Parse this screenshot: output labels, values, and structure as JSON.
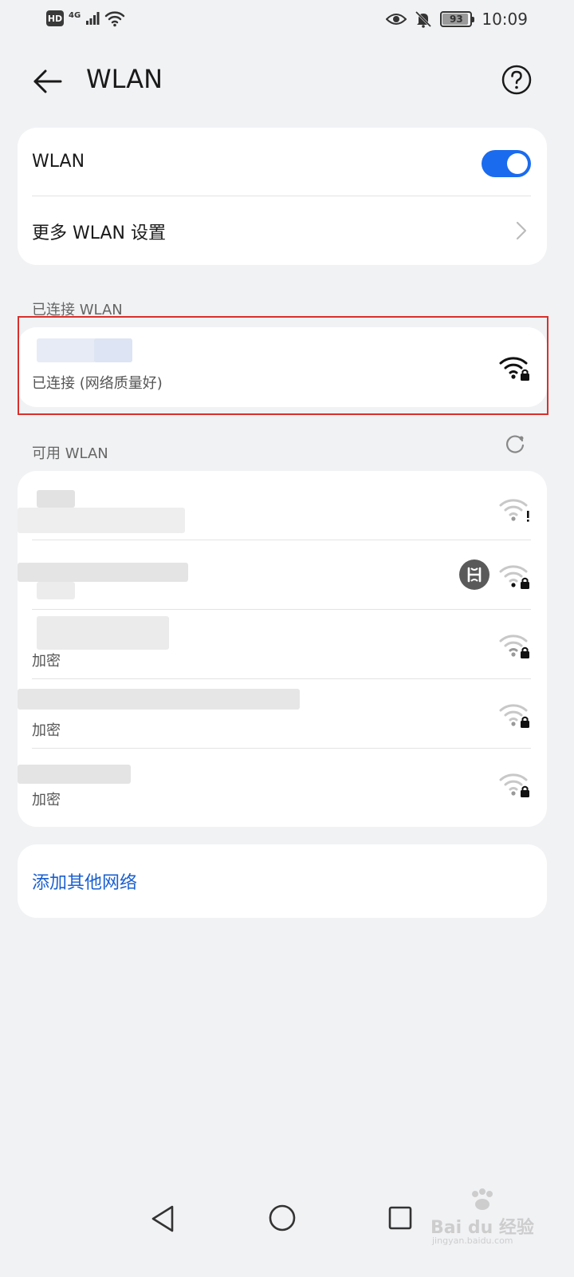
{
  "status_bar": {
    "hd_label": "HD",
    "network_label": "4G",
    "battery_level": "93",
    "battery_percent": 93,
    "time": "10:09"
  },
  "header": {
    "title": "WLAN",
    "back_icon": "back-arrow-icon",
    "help_icon": "help-icon"
  },
  "settings": {
    "wlan_label": "WLAN",
    "wlan_enabled": true,
    "more_label": "更多 WLAN 设置"
  },
  "connected": {
    "section_label": "已连接 WLAN",
    "status": "已连接 (网络质量好)"
  },
  "available": {
    "section_label": "可用 WLAN",
    "networks": [
      {
        "sub": "",
        "signal_icon": "wifi-alert-icon"
      },
      {
        "sub": "",
        "signal_icon": "wifi-lock-icon",
        "hotspot_icon": "hotspot-icon"
      },
      {
        "sub": "加密",
        "signal_icon": "wifi-lock-icon"
      },
      {
        "sub": "加密",
        "signal_icon": "wifi-lock-icon"
      },
      {
        "sub": "加密",
        "signal_icon": "wifi-lock-icon"
      }
    ]
  },
  "add_network_label": "添加其他网络",
  "watermark": {
    "brand": "Bai du 经验",
    "url": "jingyan.baidu.com"
  },
  "colors": {
    "accent": "#1a6bee",
    "link": "#1a5fd0",
    "highlight": "#d9302c",
    "background": "#f1f2f4"
  }
}
